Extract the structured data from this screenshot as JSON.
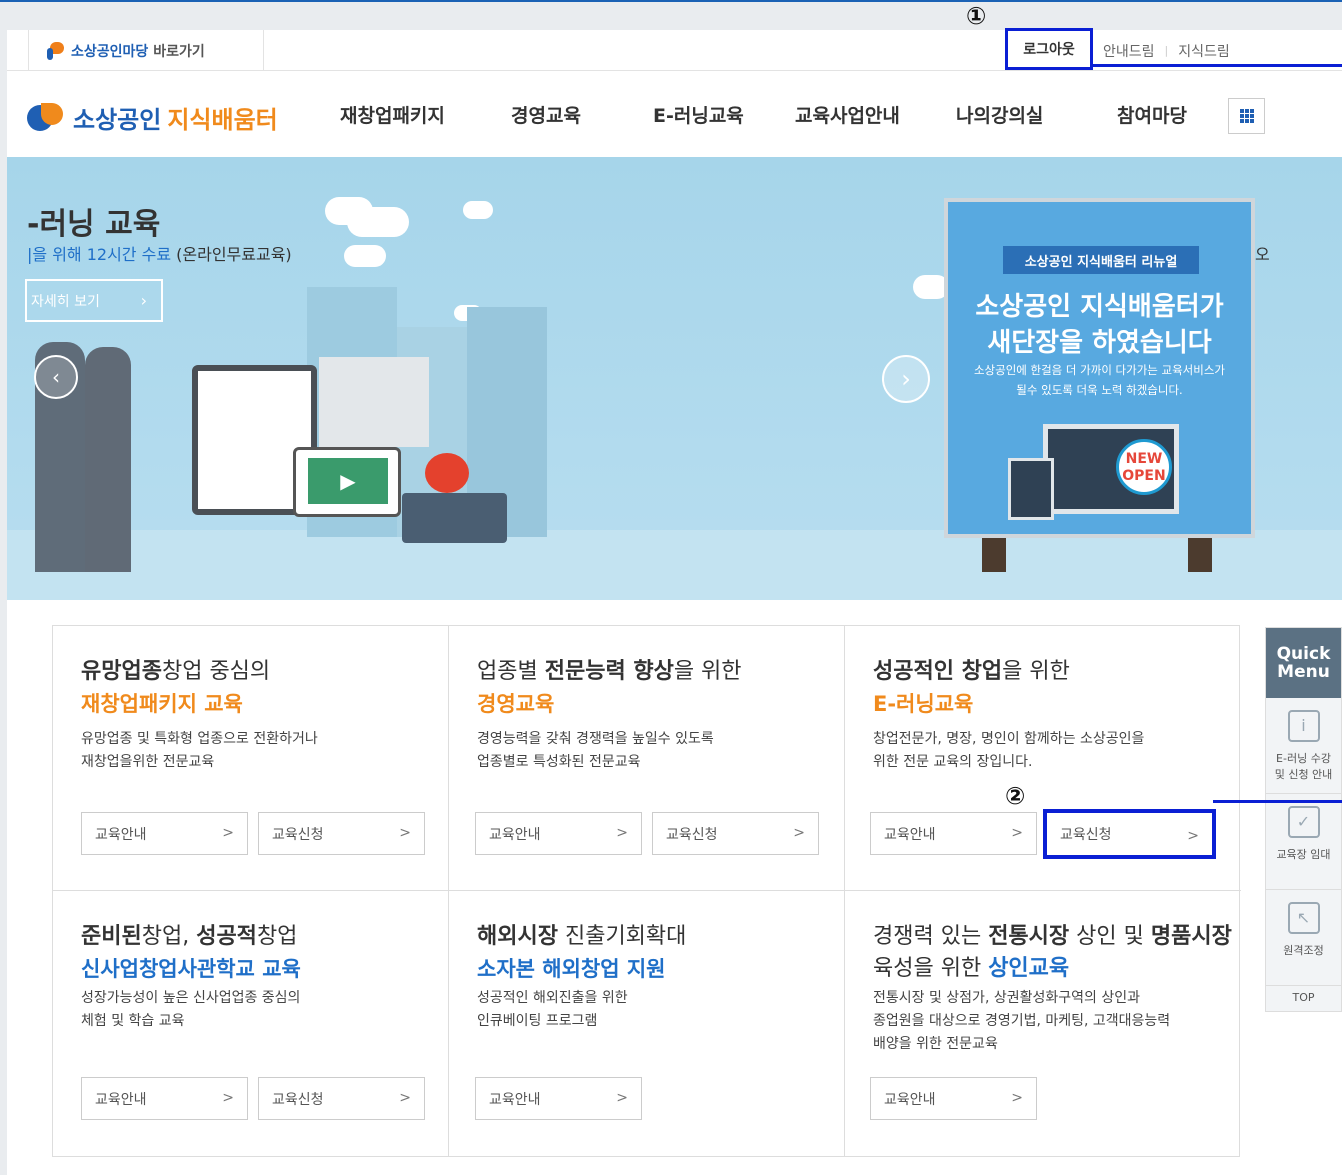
{
  "util": {
    "market_brand": "소상공인마당",
    "market_link": "바로가기",
    "logout": "로그아웃",
    "guide": "안내드림",
    "knowledge": "지식드림"
  },
  "annotations": {
    "m1": "①",
    "m2": "②"
  },
  "header": {
    "logo_part1": "소상공인",
    "logo_part2": "지식배움터",
    "menu": [
      "재창업패키지",
      "경영교육",
      "E-러닝교육",
      "교육사업안내",
      "나의강의실",
      "참여마당"
    ]
  },
  "banner": {
    "title": "-러닝 교육",
    "sub_highlight": "|을 위해 12시간 수료",
    "sub_rest": " (온라인무료교육)",
    "more": "자세히 보기",
    "board": {
      "ribbon": "소상공인 지식배움터 리뉴얼",
      "line1": "소상공인 지식배움터가",
      "line2": "새단장을 하였습니다",
      "small1": "소상공인에 한걸음 더 가까이 다가가는 교육서비스가",
      "small2": "될수 있도록 더욱 노력 하겠습니다.",
      "badge1": "NEW",
      "badge2": "OPEN"
    },
    "peek": "오"
  },
  "cards": [
    {
      "head_bold": "유망업종",
      "head_rest": "창업 중심의",
      "accent": "재창업패키지 교육",
      "accent_color": "orange",
      "desc1": "유망업종 및 특화형 업종으로 전환하거나",
      "desc2": "재창업을위한 전문교육",
      "desc3": "",
      "btn1": "교육안내",
      "btn2": "교육신청"
    },
    {
      "head_pre": "업종별 ",
      "head_bold": "전문능력 향상",
      "head_rest": "을 위한",
      "accent": "경영교육",
      "accent_color": "orange",
      "desc1": "경영능력을 갖춰 경쟁력을 높일수 있도록",
      "desc2": "업종별로 특성화된 전문교육",
      "desc3": "",
      "btn1": "교육안내",
      "btn2": "교육신청"
    },
    {
      "head_bold": "성공적인 창업",
      "head_rest": "을 위한",
      "accent": "E-러닝교육",
      "accent_color": "orange",
      "desc1": "창업전문가, 명장, 명인이 함께하는 소상공인을",
      "desc2": "위한 전문 교육의 장입니다.",
      "desc3": "",
      "btn1": "교육안내",
      "btn2": "교육신청"
    },
    {
      "head_bold": "준비된",
      "head_rest": "창업, ",
      "head_bold2": "성공적",
      "head_rest2": "창업",
      "accent": "신사업창업사관학교 교육",
      "accent_color": "blue",
      "desc1": "성장가능성이 높은 신사업업종 중심의",
      "desc2": "체험 및 학습 교육",
      "desc3": "",
      "btn1": "교육안내",
      "btn2": "교육신청"
    },
    {
      "head_bold": "해외시장",
      "head_rest": " 진출기회확대",
      "accent": "소자본 해외창업 지원",
      "accent_color": "blue",
      "desc1": "성공적인 해외진출을 위한",
      "desc2": "인큐베이팅 프로그램",
      "desc3": "",
      "btn1": "교육안내"
    },
    {
      "head_pre": "경쟁력 있는 ",
      "head_bold": "전통시장",
      "head_rest": " 상인 및 ",
      "head_bold2": "명품시장",
      "line2_pre": "육성을 위한 ",
      "accent": "상인교육",
      "accent_color": "blue",
      "desc1": "전통시장 및 상점가, 상권활성화구역의 상인과",
      "desc2": "종업원을 대상으로 경영기법, 마케팅, 고객대응능력",
      "desc3": "배양을 위한 전문교육",
      "btn1": "교육안내"
    }
  ],
  "quick": {
    "title1": "Quick",
    "title2": "Menu",
    "items": [
      {
        "icon": "monitor-info-icon",
        "label1": "E-러닝 수강",
        "label2": "및 신청 안내"
      },
      {
        "icon": "checkbox-icon",
        "label1": "교육장 임대",
        "label2": ""
      },
      {
        "icon": "remote-icon",
        "label1": "원격조정",
        "label2": ""
      }
    ],
    "top": "TOP"
  },
  "colors": {
    "brand_blue": "#1f5fb3",
    "brand_orange": "#f08a1c",
    "annotation": "#0a1fd4"
  }
}
